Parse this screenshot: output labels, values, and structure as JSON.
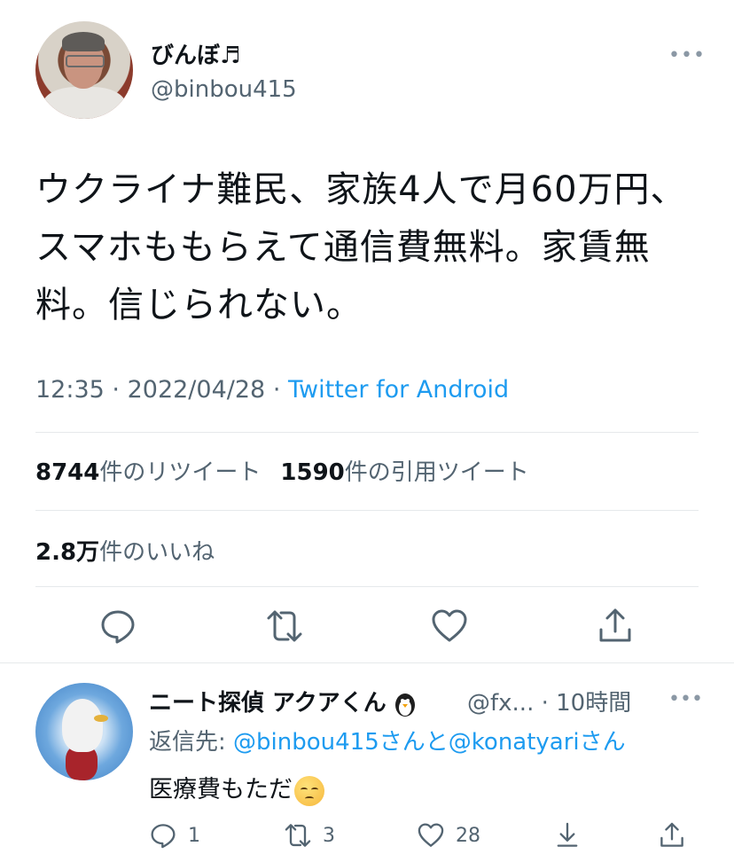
{
  "author": {
    "display_name": "びんぼ♬",
    "handle": "@binbou415",
    "more": "•••"
  },
  "tweet": {
    "text": "ウクライナ難民、家族4人で月60万円、スマホももらえて通信費無料。家賃無料。信じられない。",
    "time": "12:35",
    "date": "2022/04/28",
    "separator": "·",
    "source": "Twitter for Android"
  },
  "stats": {
    "retweets_count": "8744",
    "retweets_label": "件のリツイート",
    "quotes_count": "1590",
    "quotes_label": "件の引用ツイート",
    "likes_count": "2.8万",
    "likes_label": "件のいいね"
  },
  "actions": {
    "reply_icon": "reply-icon",
    "retweet_icon": "retweet-icon",
    "like_icon": "heart-icon",
    "share_icon": "share-icon"
  },
  "reply": {
    "display_name": "ニート探偵 アクアくん",
    "handle": "@fx...",
    "time_sep": "·",
    "time": "10時間",
    "more": "•••",
    "replying_to_label": "返信先: ",
    "mention1": "@binbou415",
    "san1": "さんと",
    "mention2": "@konatyari",
    "san2": "さん",
    "text": "医療費もただ",
    "reply_count": "1",
    "retweet_count": "3",
    "like_count": "28"
  },
  "colors": {
    "accent": "#1d9bf0",
    "text": "#0f1419",
    "secondary": "#536471",
    "divider": "#e6e9eb"
  }
}
